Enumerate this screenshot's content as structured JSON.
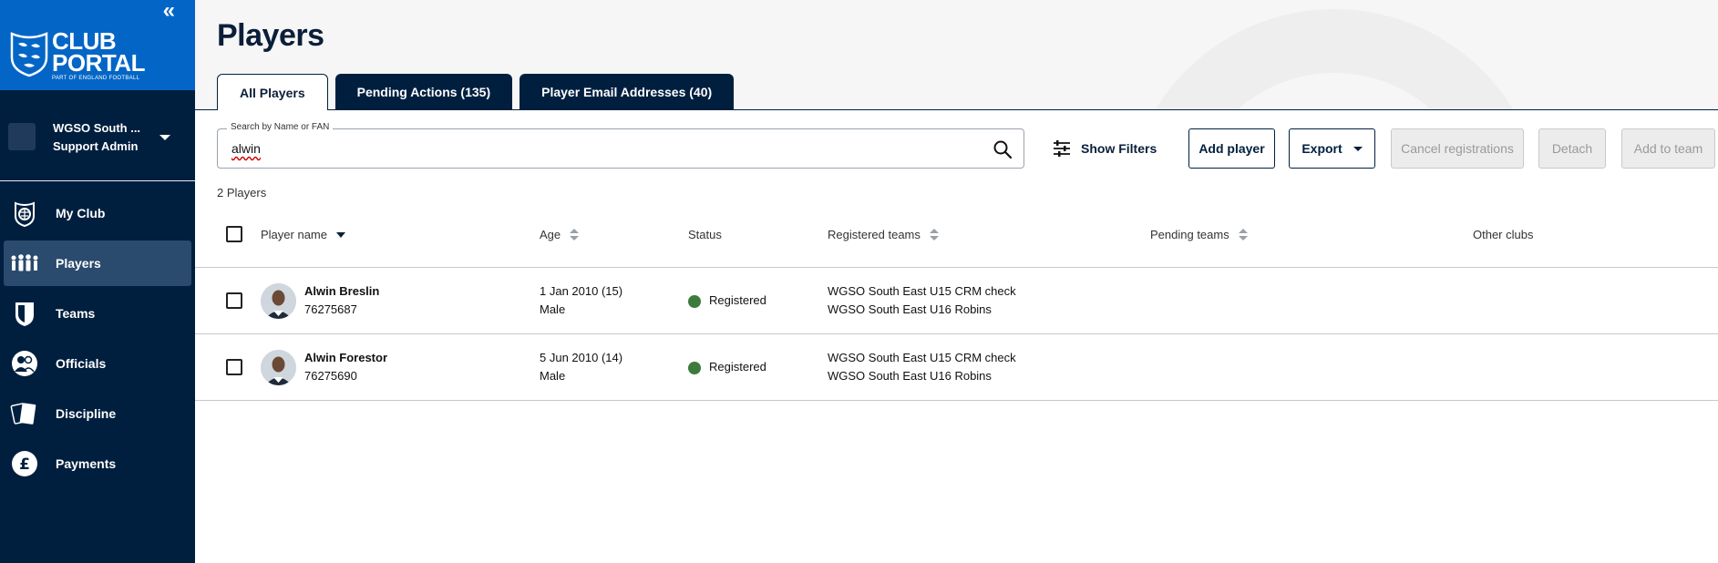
{
  "sidebar": {
    "brand": {
      "line1": "CLUB",
      "line2": "PORTAL",
      "tagline": "PART OF ENGLAND FOOTBALL"
    },
    "account": {
      "name": "WGSO South ...",
      "role": "Support Admin"
    },
    "items": [
      {
        "label": "My Club",
        "icon": "club-crest-icon",
        "active": false
      },
      {
        "label": "Players",
        "icon": "players-group-icon",
        "active": true
      },
      {
        "label": "Teams",
        "icon": "team-shield-icon",
        "active": false
      },
      {
        "label": "Officials",
        "icon": "officials-icon",
        "active": false
      },
      {
        "label": "Discipline",
        "icon": "cards-icon",
        "active": false
      },
      {
        "label": "Payments",
        "icon": "pound-icon",
        "active": false
      }
    ]
  },
  "page": {
    "title": "Players",
    "tabs": [
      {
        "label": "All Players",
        "active": true
      },
      {
        "label": "Pending Actions (135)",
        "active": false
      },
      {
        "label": "Player Email Addresses (40)",
        "active": false
      }
    ]
  },
  "toolbar": {
    "search_label": "Search by Name or FAN",
    "search_value": "alwin",
    "show_filters": "Show Filters",
    "add_player": "Add player",
    "export": "Export",
    "cancel_registrations": "Cancel registrations",
    "detach": "Detach",
    "add_to_team": "Add to team"
  },
  "results": {
    "count_text": "2 Players"
  },
  "table": {
    "headers": {
      "player_name": "Player name",
      "age": "Age",
      "status": "Status",
      "registered_teams": "Registered teams",
      "pending_teams": "Pending teams",
      "other_clubs": "Other clubs"
    },
    "rows": [
      {
        "name": "Alwin Breslin",
        "fan": "76275687",
        "dob_age": "1 Jan 2010 (15)",
        "gender": "Male",
        "status": "Registered",
        "team1": "WGSO South East U15 CRM check",
        "team2": "WGSO South East U16 Robins"
      },
      {
        "name": "Alwin Forestor",
        "fan": "76275690",
        "dob_age": "5 Jun 2010 (14)",
        "gender": "Male",
        "status": "Registered",
        "team1": "WGSO South East U15 CRM check",
        "team2": "WGSO South East U16 Robins"
      }
    ]
  },
  "colors": {
    "navy": "#001f3f",
    "brand_blue": "#0366c6",
    "active_nav": "#2a4a6e",
    "status_registered": "#3d7a3d"
  }
}
